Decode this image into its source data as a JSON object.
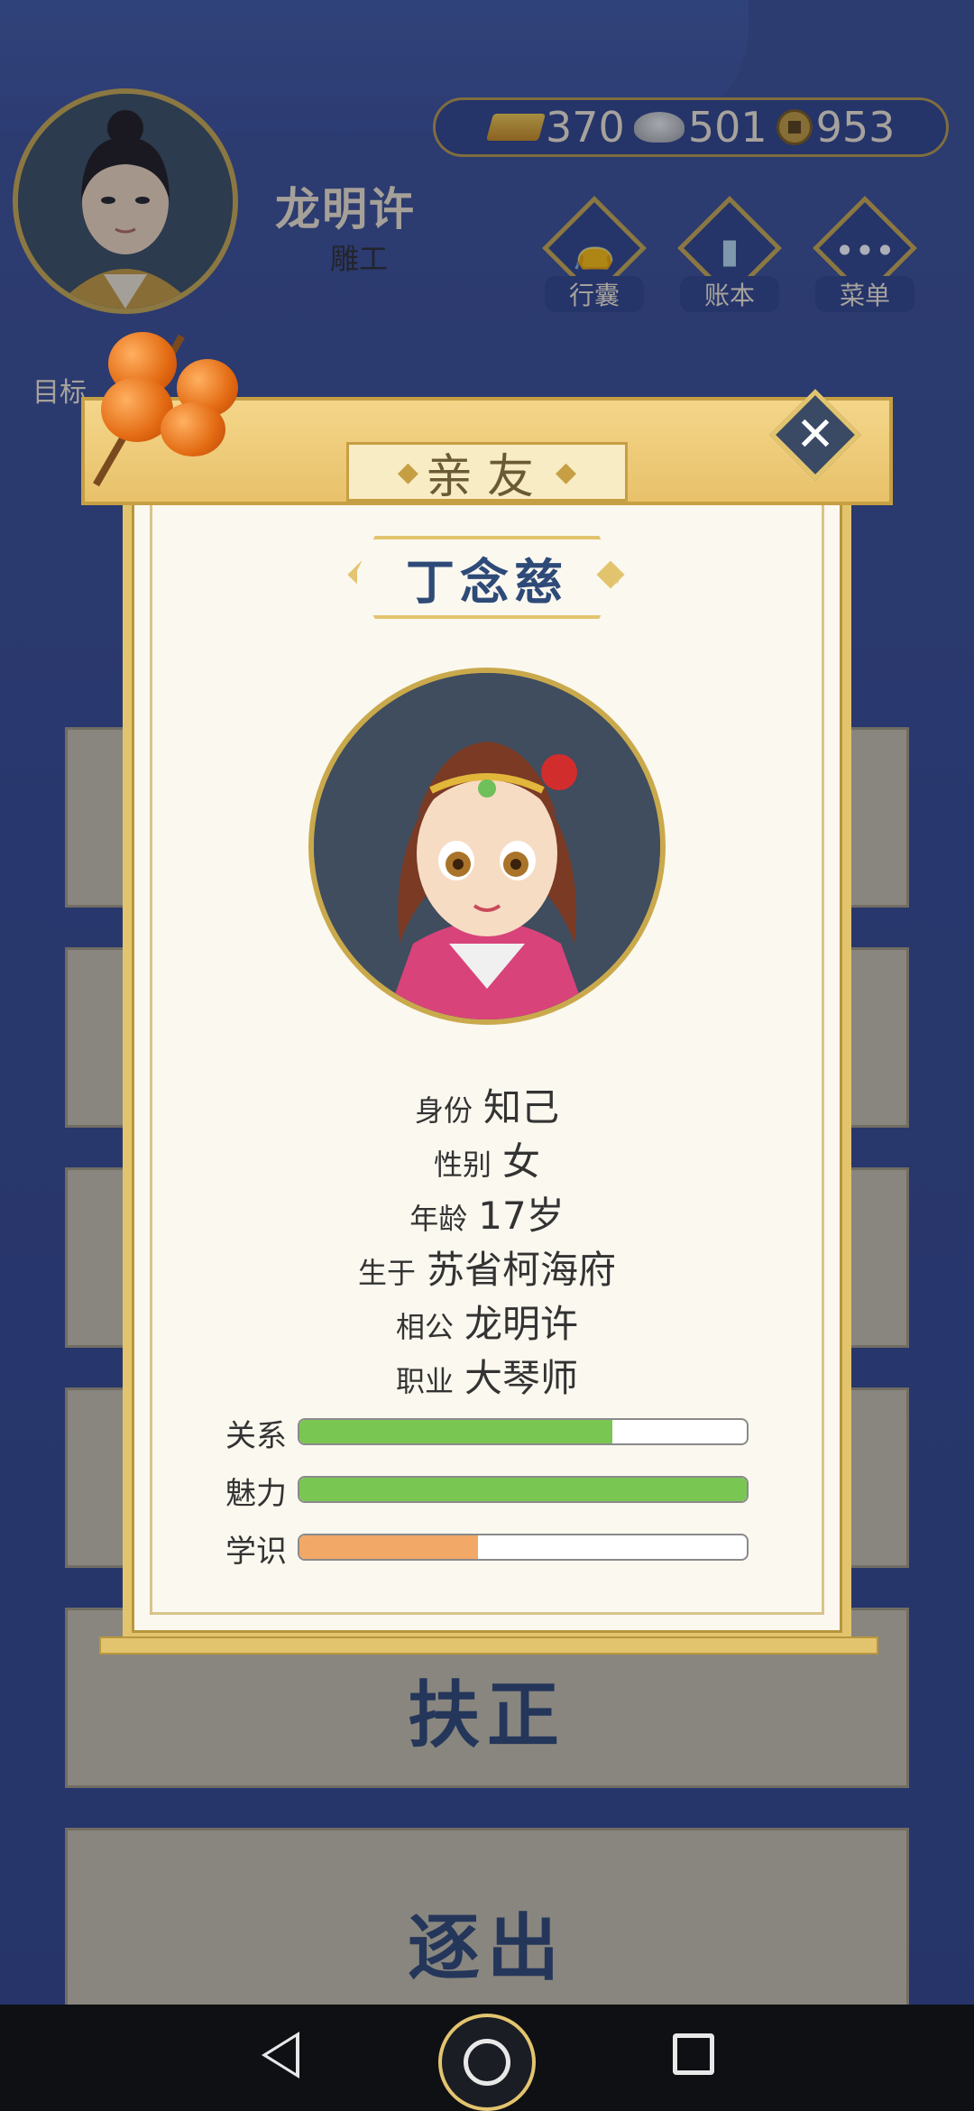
{
  "player": {
    "name": "龙明许",
    "job": "雕工"
  },
  "currency": {
    "gold": "370",
    "silver": "501",
    "copper": "953"
  },
  "hud_buttons": [
    {
      "label": "行囊",
      "icon": "bag-icon"
    },
    {
      "label": "账本",
      "icon": "ledger-icon"
    },
    {
      "label": "菜单",
      "icon": "menu-dots-icon"
    }
  ],
  "goal_label": "目标",
  "modal": {
    "title": "亲友",
    "name": "丁念慈",
    "info": [
      {
        "key": "身份",
        "value": "知己"
      },
      {
        "key": "性别",
        "value": "女"
      },
      {
        "key": "年龄",
        "value": "17岁"
      },
      {
        "key": "生于",
        "value": "苏省柯海府"
      },
      {
        "key": "相公",
        "value": "龙明许"
      },
      {
        "key": "职业",
        "value": "大琴师"
      }
    ],
    "stats": [
      {
        "label": "关系",
        "value": 0.7,
        "color": "#7ac653"
      },
      {
        "label": "魅力",
        "value": 1.0,
        "color": "#7ac653"
      },
      {
        "label": "学识",
        "value": 0.4,
        "color": "#f2a866"
      }
    ]
  },
  "actions": {
    "promote": "扶正",
    "expel": "逐出"
  }
}
